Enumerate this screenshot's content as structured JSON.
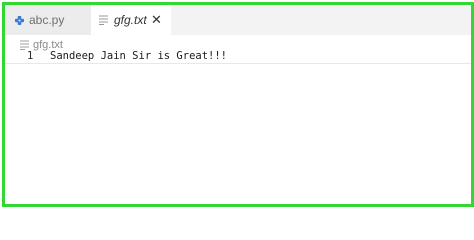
{
  "tabs": [
    {
      "label": "abc.py",
      "active": false,
      "icon": "python-file-icon"
    },
    {
      "label": "gfg.txt",
      "active": true,
      "icon": "text-file-icon"
    }
  ],
  "close_glyph": "✕",
  "breadcrumb": {
    "label": "gfg.txt"
  },
  "editor": {
    "lines": [
      {
        "number": "1",
        "content": "Sandeep Jain Sir is Great!!!"
      }
    ]
  },
  "colors": {
    "frame_border": "#33d633",
    "python_icon": "#3b7ccf"
  }
}
